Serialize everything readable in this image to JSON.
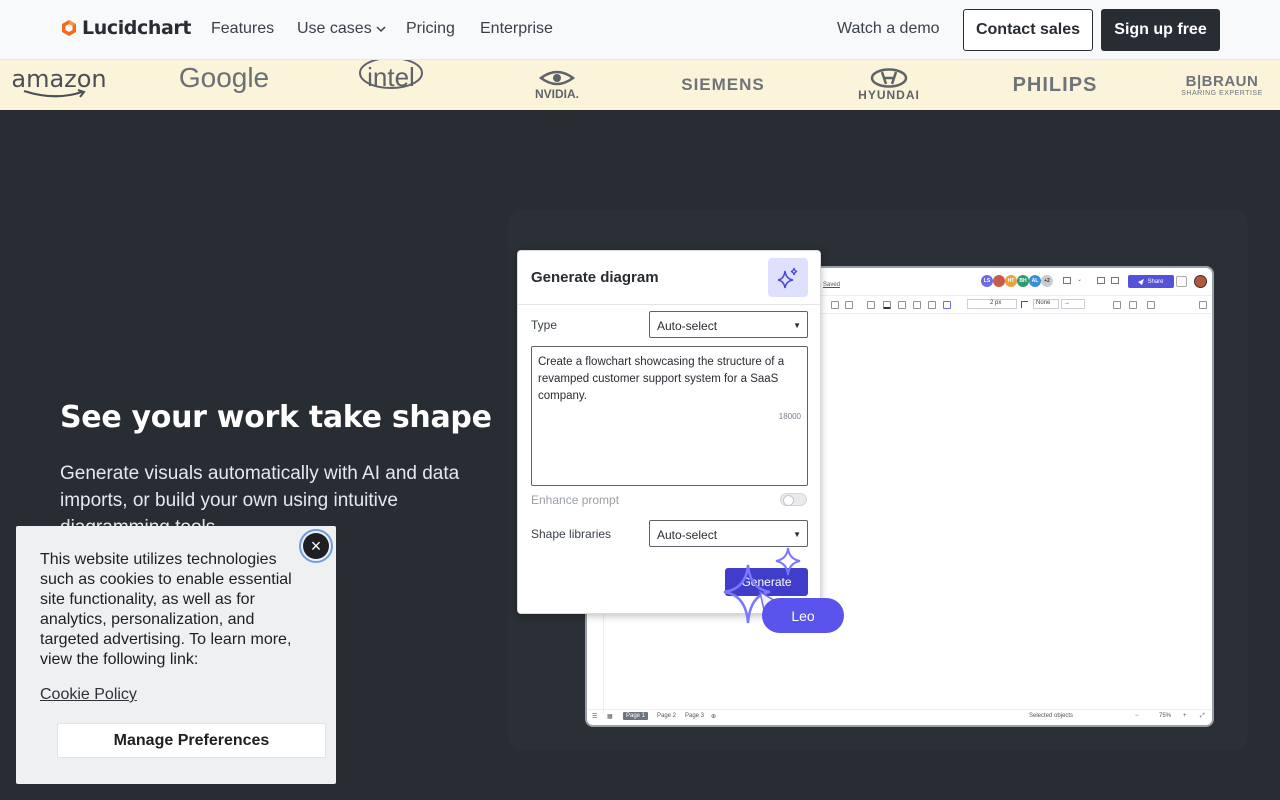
{
  "nav": {
    "logo_text": "Lucidchart",
    "links": [
      {
        "label": "Features"
      },
      {
        "label": "Use cases"
      },
      {
        "label": "Pricing"
      },
      {
        "label": "Enterprise"
      },
      {
        "label": "Watch a demo"
      }
    ],
    "contact_label": "Contact sales",
    "signup_label": "Sign up free"
  },
  "brands": [
    "amazon",
    "Google",
    "intel",
    "NVIDIA.",
    "SIEMENS",
    "HYUNDAI",
    "PHILIPS",
    "B|BRAUN",
    "SHARING EXPERTISE"
  ],
  "hero": {
    "title": "See your work take shape",
    "description": "Generate visuals automatically with AI and data imports, or build your own using intuitive diagramming tools."
  },
  "editor": {
    "saved": "Saved",
    "avatars": [
      "LS",
      "",
      "HT",
      "BH",
      "AL",
      "+2"
    ],
    "share_label": "Share",
    "toolbar_texts": [
      "2 px",
      "None"
    ],
    "pages": [
      "Page 1",
      "Page 2",
      "Page 3"
    ],
    "selected_label": "Selected objects",
    "zoom": "75%"
  },
  "dialog": {
    "title": "Generate diagram",
    "type_label": "Type",
    "type_value": "Auto-select",
    "prompt_text": "Create a flowchart showcasing the structure of a revamped customer support system for a SaaS company.",
    "char_count": "18000",
    "enhance_label": "Enhance prompt",
    "enhance_on": false,
    "libraries_label": "Shape libraries",
    "libraries_value": "Auto-select",
    "generate_label": "Generate"
  },
  "leo_label": "Leo",
  "cookie": {
    "text": "This website utilizes technologies such as cookies to enable essential site functionality, as well as for analytics, personalization, and targeted advertising. To learn more, view the following link:",
    "policy_link": "Cookie Policy",
    "manage_label": "Manage Preferences"
  },
  "colors": {
    "accent": "#5352d8",
    "brand_orange": "#f26b1d",
    "dark": "#282c33",
    "logo_strip": "#fcf3db"
  }
}
